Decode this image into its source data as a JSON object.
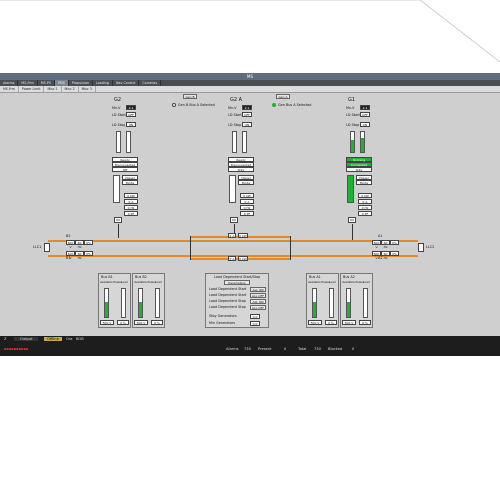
{
  "window": {
    "title": "MS"
  },
  "tabs": [
    "Alarms",
    "MS-Frm",
    "MS-PS",
    "PMS",
    "Propulsion",
    "Loading",
    "Nav Control",
    "Cameras"
  ],
  "subtabs": [
    "MS-Frm",
    "Power Limit",
    "Misc 1",
    "Misc 2",
    "Misc 3"
  ],
  "buttons": {
    "genset_a": "Gen B",
    "genset_b": "Gen A"
  },
  "options": {
    "opt_a": "Gen B Bus A Selected",
    "opt_b": "Gen Bus A Selected"
  },
  "generators": [
    {
      "name": "G2",
      "mode": "Mn-V",
      "mode_val": "2:1",
      "ld_start": "LD Start",
      "ld_start_val": "OFF",
      "ld_stop": "LD Stop",
      "ld_stop_val": "ON",
      "status": [
        "Ready",
        "Disconnected",
        "Off"
      ],
      "gov": [
        "Diesel",
        "Mode"
      ],
      "vals": [
        "0 kW",
        "0 A",
        "0 Hz",
        "0 PF"
      ],
      "num": "60"
    },
    {
      "name": "G2 A",
      "mode": "Mn-V",
      "mode_val": "2:1",
      "ld_start": "LD Start",
      "ld_start_val": "OFF",
      "ld_stop": "LD Stop",
      "ld_stop_val": "ON",
      "status": [
        "Ready",
        "Disconnected",
        "Stby"
      ],
      "gov": [
        "Diesel",
        "Mode"
      ],
      "vals": [
        "0 kW",
        "0 A",
        "0 Hz",
        "0 PF"
      ],
      "num": "60"
    },
    {
      "name": "G1",
      "mode": "Mn-V",
      "mode_val": "2:1",
      "ld_start": "LD Start",
      "ld_start_val": "OFF",
      "ld_stop": "LD Stop",
      "ld_stop_val": "ON",
      "status": [
        "Running",
        "Connected",
        "Stby"
      ],
      "gov": [
        "Diesel",
        "Mode"
      ],
      "vals": [
        "0 kW",
        "0 A",
        "0 Hz",
        "0 PF"
      ],
      "num": "60"
    }
  ],
  "bus": {
    "left_label": "LLC1",
    "right_label": "LLC2",
    "b2": "B2",
    "b1": "B1",
    "a1": "A1",
    "a2": "A2",
    "b2_vals": [
      "600 V",
      "60 Hz",
      "0%"
    ],
    "b1_vals": [
      "600 V",
      "60 Hz",
      "0%"
    ],
    "a1_vals": [
      "600 V",
      "60 Hz",
      "0%"
    ],
    "a2_vals": [
      "600 V",
      "60 Hz",
      "0%"
    ],
    "tie_top": [
      "0 A",
      "0 kW"
    ],
    "tie_bottom": [
      "0 A",
      "0 kW"
    ]
  },
  "bus_panels": {
    "bus_b1": {
      "title": "Bus B1",
      "avail": "Available Power",
      "load": "Load",
      "vals": [
        "500 V",
        "0 %"
      ]
    },
    "bus_b2": {
      "title": "Bus B2",
      "avail": "Available Power",
      "load": "Load",
      "vals": [
        "500 V",
        "0 %"
      ]
    },
    "bus_a1": {
      "title": "Bus A1",
      "avail": "Available Power",
      "load": "Load",
      "vals": [
        "500 V",
        "0 %"
      ]
    },
    "bus_a2": {
      "title": "Bus A2",
      "avail": "Available Power",
      "load": "Load",
      "vals": [
        "500 V",
        "0 %"
      ]
    }
  },
  "ld_panel": {
    "title": "Load Dependent Start/Stop",
    "parameters": "Parameters",
    "rows": [
      {
        "label": "Load Dependent Start",
        "val": "ALL ON"
      },
      {
        "label": "Load Dependent Start",
        "val": "ALL OFF"
      },
      {
        "label": "Load Dependent Stop",
        "val": "ALL ON"
      },
      {
        "label": "Load Dependent Stop",
        "val": "ALL OFF"
      }
    ],
    "stby": "Stby Generators",
    "stby_val": "0.0",
    "min": "Min Generators",
    "min_val": "0.0"
  },
  "taskbar": {
    "row1": [
      "Z",
      "Output",
      "Offline",
      "Ora",
      "BOB"
    ],
    "row2": [
      "Alarms",
      "730",
      "Present",
      "0",
      "Total",
      "730",
      "Blocked",
      "0"
    ]
  },
  "colors": {
    "accent": "#1db233",
    "bus": "#e08a2a",
    "titlebar": "#5f6e7e"
  }
}
